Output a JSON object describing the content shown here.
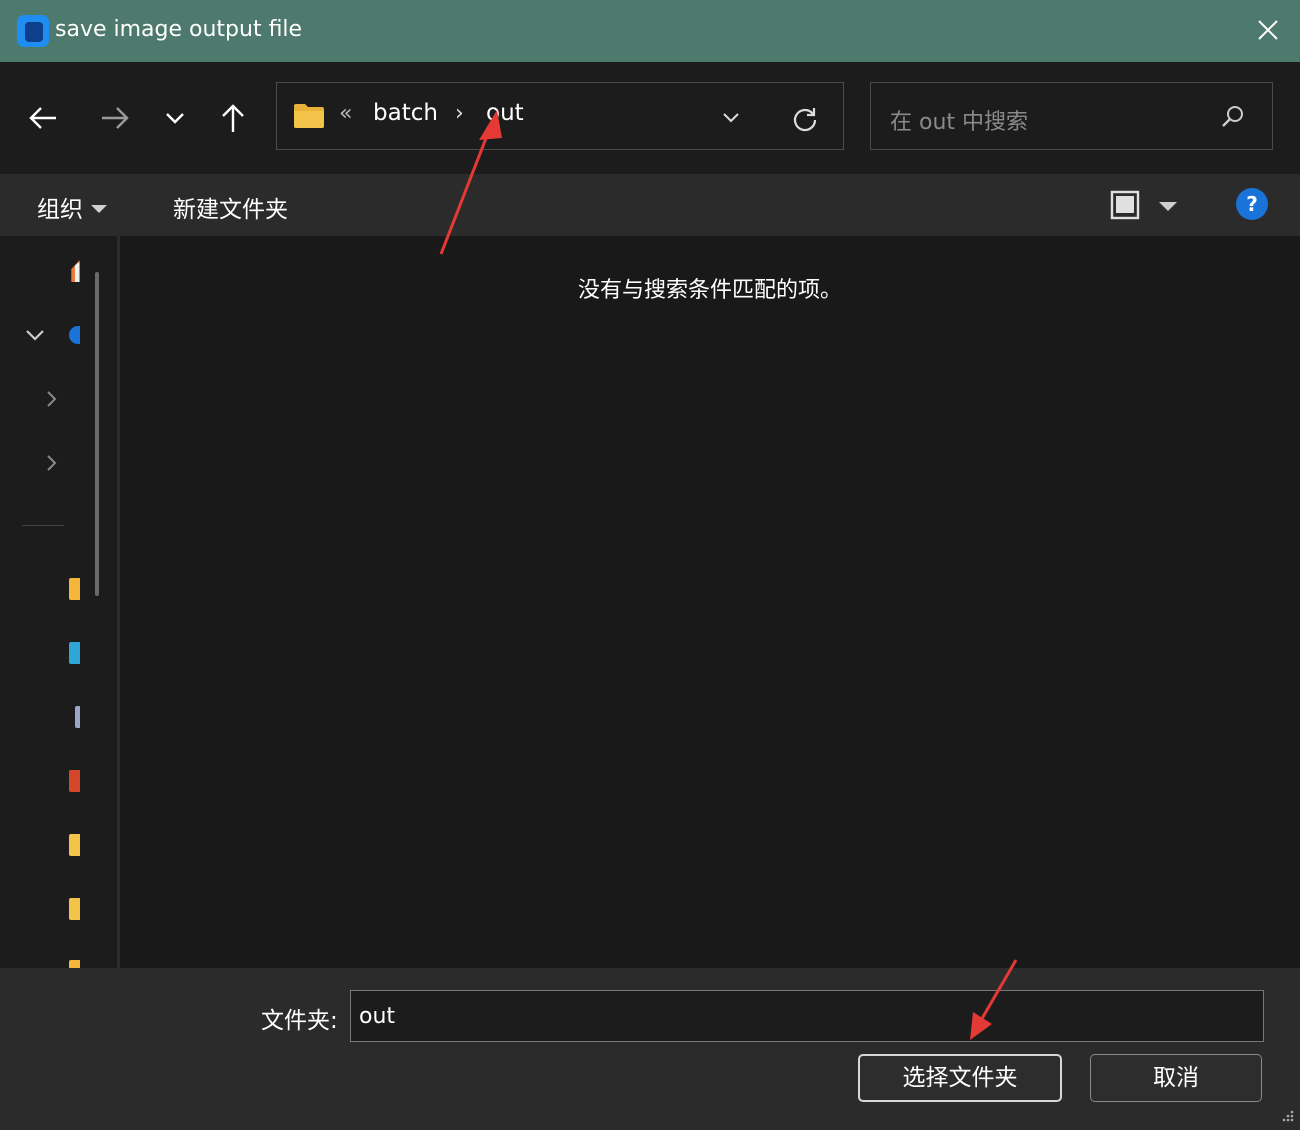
{
  "window": {
    "title": "save image output file"
  },
  "nav": {
    "back_icon": "arrow-left-icon",
    "forward_icon": "arrow-right-icon",
    "recent_icon": "chevron-down-icon",
    "up_icon": "arrow-up-icon"
  },
  "address": {
    "overflow": "«",
    "crumbs": [
      "batch",
      "out"
    ],
    "separator": "›"
  },
  "search": {
    "placeholder": "在 out 中搜索"
  },
  "commands": {
    "organize": "组织",
    "new_folder": "新建文件夹",
    "help": "?"
  },
  "content": {
    "empty_message": "没有与搜索条件匹配的项。"
  },
  "footer": {
    "folder_label": "文件夹:",
    "folder_value": "out",
    "select_button": "选择文件夹",
    "cancel_button": "取消"
  },
  "colors": {
    "titlebar": "#4e7a6e",
    "accent": "#1a73d9",
    "annotation": "#e53935",
    "folder": "#f3c34a"
  }
}
